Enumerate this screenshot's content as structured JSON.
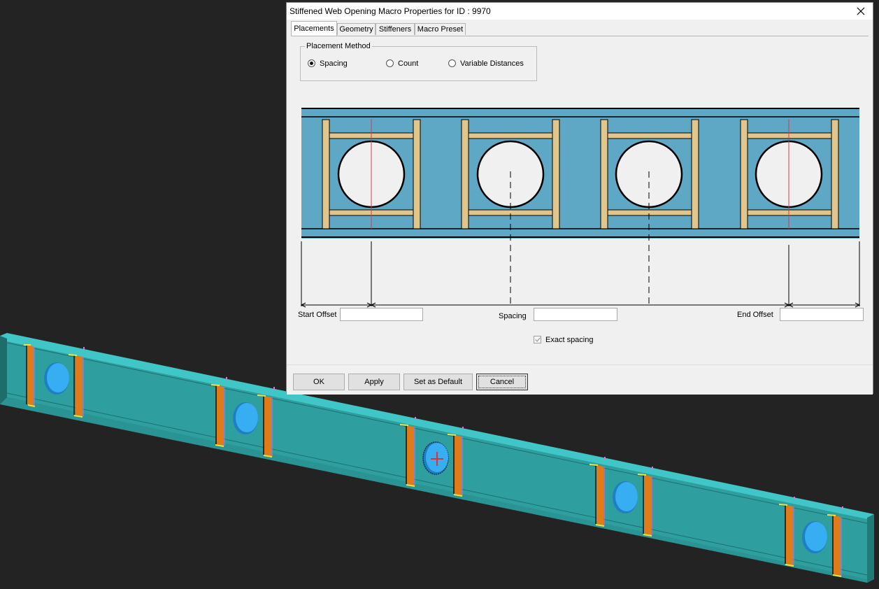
{
  "dialog": {
    "title": "Stiffened Web Opening Macro Properties for ID : 9970",
    "tabs": [
      "Placements",
      "Geometry",
      "Stiffeners",
      "Macro Preset"
    ],
    "active_tab": "Placements",
    "placement_method": {
      "legend": "Placement Method",
      "options": [
        "Spacing",
        "Count",
        "Variable Distances"
      ],
      "selected": "Spacing"
    },
    "fields": {
      "start_offset_label": "Start Offset",
      "start_offset_value": "",
      "spacing_label": "Spacing",
      "spacing_value": "",
      "end_offset_label": "End Offset",
      "end_offset_value": ""
    },
    "exact_spacing": {
      "label": "Exact spacing",
      "checked": true,
      "enabled": false
    },
    "buttons": {
      "ok": "OK",
      "apply": "Apply",
      "set_default": "Set as Default",
      "cancel": "Cancel"
    }
  },
  "colors": {
    "beam_steel": "#2e9e9e",
    "beam_flange_top": "#3dc8c8",
    "stiffener": "#e07b1a",
    "opening": "#35aaf0",
    "diagram_web": "#5ea7c5",
    "diagram_stiffener": "#e0c68c",
    "centerline": "#d43a55"
  }
}
